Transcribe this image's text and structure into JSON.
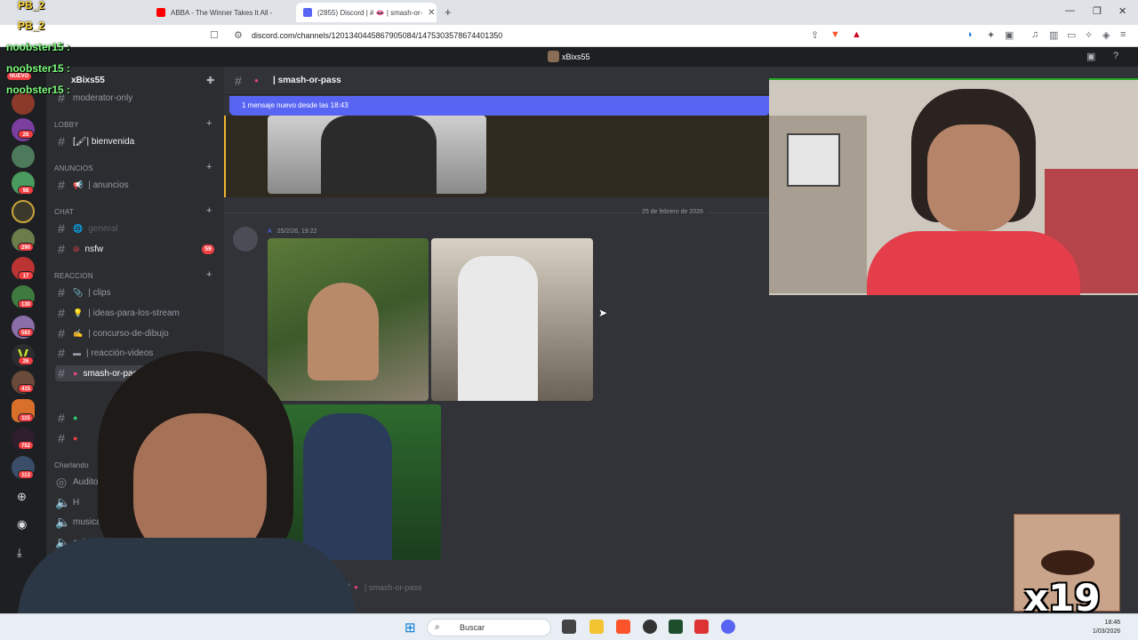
{
  "browser": {
    "tabs": [
      {
        "label": "ABBA - The Winner Takes It All -",
        "favicon_color": "#ff0000"
      },
      {
        "label": "(2855) Discord | # 👄 | smash-or-",
        "favicon_color": "#5865f2"
      }
    ],
    "close_glyph": "✕",
    "new_tab_glyph": "+",
    "window_controls": [
      "—",
      "❐",
      "✕"
    ],
    "url": "discord.com/channels/1201340445867905084/1475303578674401350"
  },
  "discord": {
    "window_title": "xBixs55",
    "server_name": "xBixs55",
    "new_badge": "NUEVO",
    "guild_badges": [
      "26",
      "98",
      "290",
      "17",
      "130",
      "583",
      "26",
      "415",
      "115",
      "752",
      "113"
    ],
    "categories": {
      "lobby": "LOBBY",
      "anuncios": "ANUNCIOS",
      "chat": "CHAT",
      "reaccion": "REACCION",
      "charlando": "Charlando"
    },
    "channels": {
      "moderator": "moderator-only",
      "bienvenida": "[🖌| bienvenida",
      "anuncios": "| anuncios",
      "general": "general",
      "nsfw": "nsfw",
      "nsfw_badge": "59",
      "clips": "| clips",
      "ideas": "| ideas-para-los-stream",
      "concurso": "| concurso-de-dibujo",
      "reaccion_videos": "| reacción-videos",
      "smash": "smash-or-pass",
      "voice_auditorio": "Auditori",
      "voice_h": "H",
      "voice_musica": "musica",
      "voice_only": "only-st"
    },
    "header_channel": "| smash-or-pass",
    "new_messages_bar": "1 mensaje nuevo desde las 18:43",
    "date_divider": "25 de febrero de 2026",
    "message_meta": "25/2/26, 19:22",
    "message_author_initial": "A",
    "composer_placeholder": "| smash-or-pass"
  },
  "overlay": {
    "chat_names": [
      "PB_2",
      "PB_2",
      "noobster15 :",
      "noobster15 :",
      "noobster15 :"
    ],
    "multiplier": "x19"
  },
  "taskbar": {
    "search_placeholder": "Buscar",
    "time": "18:46",
    "date": "1/03/2026"
  },
  "colors": {
    "blurple": "#5865f2",
    "danger": "#f23f43",
    "chat_bg": "#313338",
    "sidebar_bg": "#2b2d31"
  }
}
